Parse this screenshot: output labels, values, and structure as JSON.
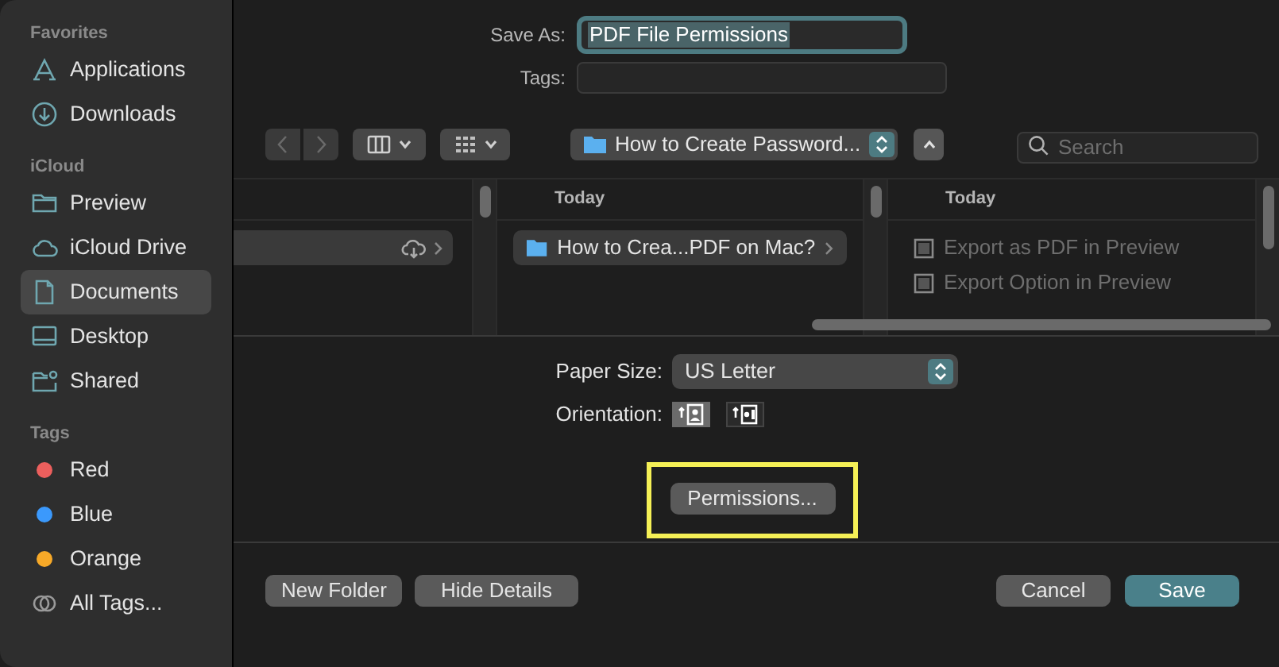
{
  "sidebar": {
    "sections": [
      {
        "heading": "Favorites",
        "items": [
          {
            "label": "Applications",
            "kind": "applications",
            "selected": false
          },
          {
            "label": "Downloads",
            "kind": "downloads",
            "selected": false
          }
        ]
      },
      {
        "heading": "iCloud",
        "items": [
          {
            "label": "Preview",
            "kind": "folder",
            "selected": false
          },
          {
            "label": "iCloud Drive",
            "kind": "cloud",
            "selected": false
          },
          {
            "label": "Documents",
            "kind": "document",
            "selected": true
          },
          {
            "label": "Desktop",
            "kind": "desktop",
            "selected": false
          },
          {
            "label": "Shared",
            "kind": "shared",
            "selected": false
          }
        ]
      },
      {
        "heading": "Tags",
        "items": [
          {
            "label": "Red",
            "kind": "tag",
            "color": "#ec5f5d",
            "selected": false
          },
          {
            "label": "Blue",
            "kind": "tag",
            "color": "#3b99fc",
            "selected": false
          },
          {
            "label": "Orange",
            "kind": "tag",
            "color": "#f7a928",
            "selected": false
          },
          {
            "label": "All Tags...",
            "kind": "all-tags",
            "selected": false
          }
        ]
      }
    ]
  },
  "save_as": {
    "label": "Save As:",
    "value": "PDF File Permissions"
  },
  "tags_field": {
    "label": "Tags:"
  },
  "toolbar": {
    "location": "How to Create Password...",
    "search_placeholder": "Search"
  },
  "browser": {
    "columns": [
      {
        "items": [
          {
            "kind": "icloud-row",
            "selected": true
          }
        ]
      },
      {
        "header": "Today",
        "items": [
          {
            "label": "How to Crea...PDF on Mac?",
            "kind": "folder",
            "selected": true,
            "disabled": false
          }
        ]
      },
      {
        "header": "Today",
        "items": [
          {
            "label": "Export as PDF in Preview",
            "kind": "image",
            "selected": false,
            "disabled": true
          },
          {
            "label": "Export Option in Preview",
            "kind": "image",
            "selected": false,
            "disabled": true
          }
        ]
      }
    ]
  },
  "paper_size": {
    "label": "Paper Size:",
    "value": "US Letter"
  },
  "orientation": {
    "label": "Orientation:",
    "options": [
      {
        "kind": "portrait",
        "selected": true
      },
      {
        "kind": "landscape",
        "selected": false
      }
    ]
  },
  "permissions_button": {
    "label": "Permissions...",
    "highlighted": true
  },
  "buttons_left": [
    {
      "label": "New Folder"
    },
    {
      "label": "Hide Details"
    }
  ],
  "buttons_right": [
    {
      "label": "Cancel",
      "kind": "normal"
    },
    {
      "label": "Save",
      "kind": "default"
    }
  ]
}
